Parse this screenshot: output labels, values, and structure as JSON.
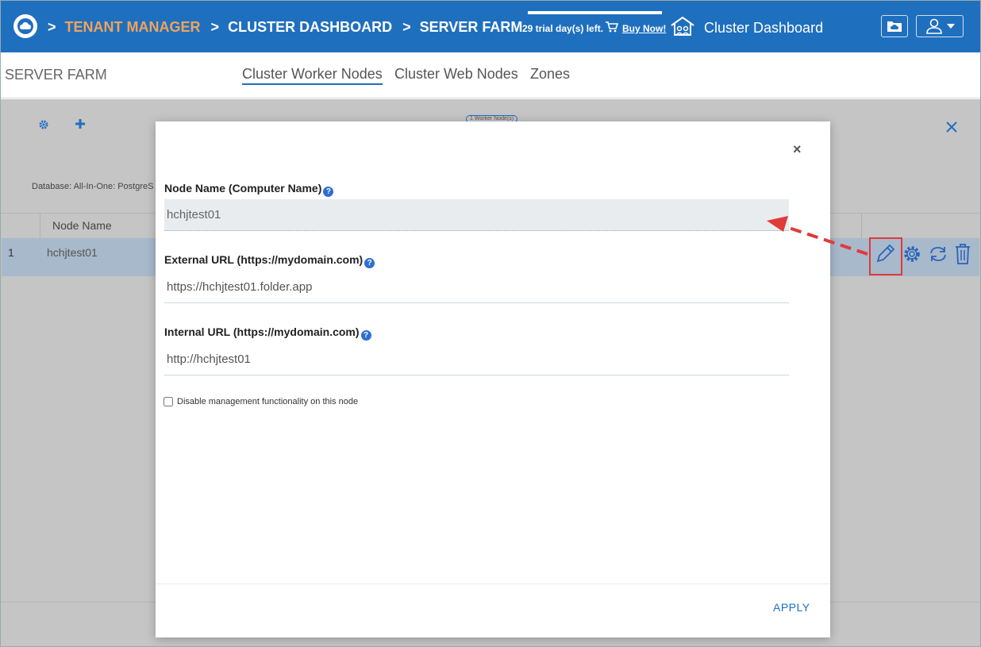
{
  "header": {
    "logo_icon": "cloud-logo-icon",
    "breadcrumb": {
      "sep": ">",
      "tenant": "TENANT MANAGER",
      "cluster": "CLUSTER DASHBOARD",
      "farm": "SERVER FARM"
    },
    "trial_text": "29 trial day(s) left.",
    "buy_now": "Buy Now!",
    "title": "Cluster Dashboard",
    "colors": {
      "bar": "#1f6fbf",
      "accent": "#f0a35e"
    }
  },
  "subnav": {
    "title": "SERVER FARM",
    "tabs": [
      {
        "label": "Cluster Worker Nodes",
        "active": true
      },
      {
        "label": "Cluster Web Nodes",
        "active": false
      },
      {
        "label": "Zones",
        "active": false
      }
    ]
  },
  "background": {
    "badge": "1 Worker Node(s)",
    "database_text": "Database: All-In-One: PostgreS",
    "table": {
      "columns": [
        "Node Name"
      ],
      "rows": [
        {
          "num": "1",
          "name": "hchjtest01"
        }
      ]
    }
  },
  "modal": {
    "close": "×",
    "fields": [
      {
        "label": "Node Name (Computer Name)",
        "value": "hchjtest01"
      },
      {
        "label": "External URL (https://mydomain.com)",
        "value": "https://hchjtest01.folder.app"
      },
      {
        "label": "Internal URL (https://mydomain.com)",
        "value": "http://hchjtest01"
      }
    ],
    "help": "?",
    "checkbox_label": "Disable management functionality on this node",
    "apply": "APPLY"
  }
}
